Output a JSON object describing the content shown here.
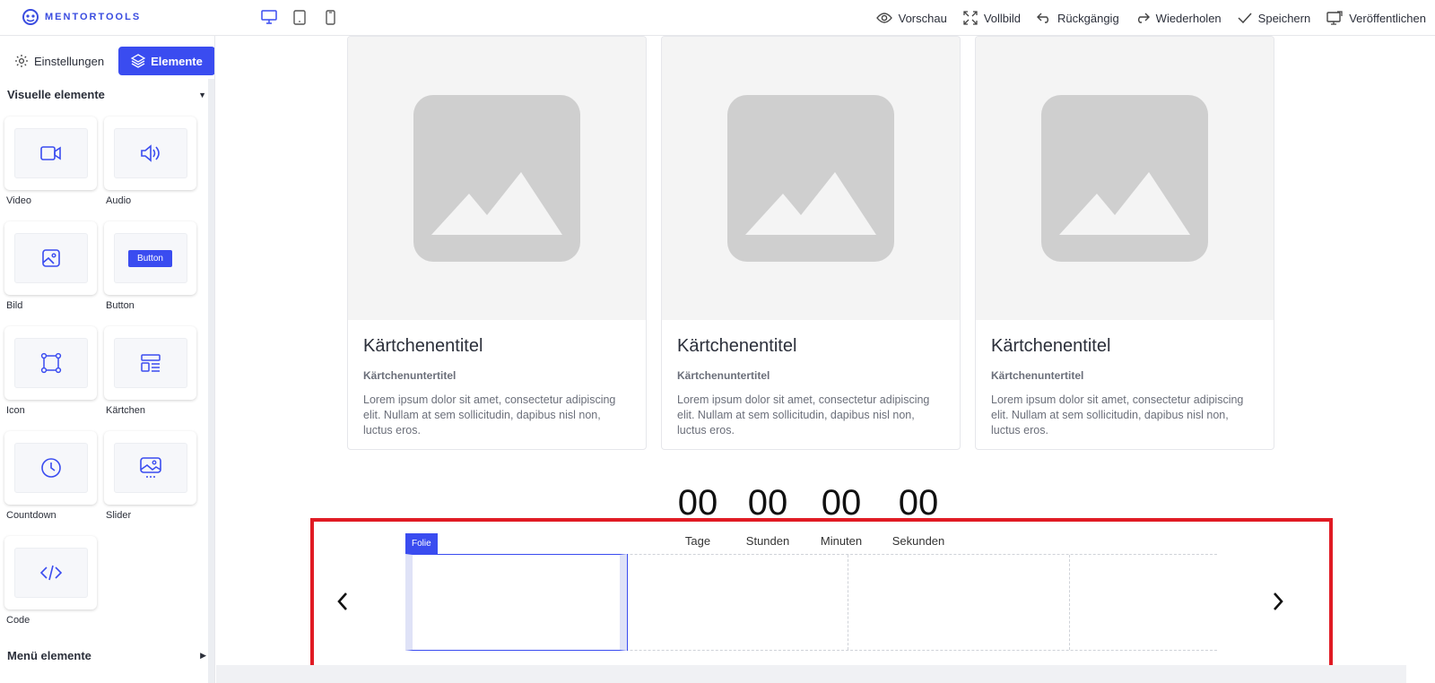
{
  "app": {
    "logo_text": "MENTORTOOLS"
  },
  "toolbar": {
    "preview_label": "Vorschau",
    "fullscreen_label": "Vollbild",
    "undo_label": "Rückgängig",
    "redo_label": "Wiederholen",
    "save_label": "Speichern",
    "publish_label": "Veröffentlichen"
  },
  "sidebar": {
    "tabs": {
      "settings_label": "Einstellungen",
      "elements_label": "Elemente"
    },
    "sections": {
      "visual": "Visuelle elemente",
      "menu": "Menü elemente"
    },
    "tiles": [
      {
        "label": "Video",
        "icon": "video-icon"
      },
      {
        "label": "Audio",
        "icon": "audio-icon"
      },
      {
        "label": "Bild",
        "icon": "image-icon"
      },
      {
        "label": "Button",
        "icon": "button-preview",
        "preview_text": "Button"
      },
      {
        "label": "Icon",
        "icon": "vector-square-icon"
      },
      {
        "label": "Kärtchen",
        "icon": "card-layout-icon"
      },
      {
        "label": "Countdown",
        "icon": "clock-icon"
      },
      {
        "label": "Slider",
        "icon": "slider-image-icon"
      },
      {
        "label": "Code",
        "icon": "code-icon"
      }
    ]
  },
  "cards": [
    {
      "title": "Kärtchenentitel",
      "subtitle": "Kärtchenuntertitel",
      "text": "Lorem ipsum dolor sit amet, consectetur adipiscing elit. Nullam at sem sollicitudin, dapibus nisl non, luctus eros."
    },
    {
      "title": "Kärtchenentitel",
      "subtitle": "Kärtchenuntertitel",
      "text": "Lorem ipsum dolor sit amet, consectetur adipiscing elit. Nullam at sem sollicitudin, dapibus nisl non, luctus eros."
    },
    {
      "title": "Kärtchenentitel",
      "subtitle": "Kärtchenuntertitel",
      "text": "Lorem ipsum dolor sit amet, consectetur adipiscing elit. Nullam at sem sollicitudin, dapibus nisl non, luctus eros."
    }
  ],
  "countdown": {
    "units": [
      {
        "value": "00",
        "label": "Tage"
      },
      {
        "value": "00",
        "label": "Stunden"
      },
      {
        "value": "00",
        "label": "Minuten"
      },
      {
        "value": "00",
        "label": "Sekunden"
      }
    ]
  },
  "slider": {
    "tag_label": "Folie",
    "prev_icon": "chevron-left-icon",
    "next_icon": "chevron-right-icon"
  },
  "colors": {
    "accent": "#3a4cf0",
    "highlight": "#e01b24",
    "placeholder": "#cfcfcf"
  }
}
